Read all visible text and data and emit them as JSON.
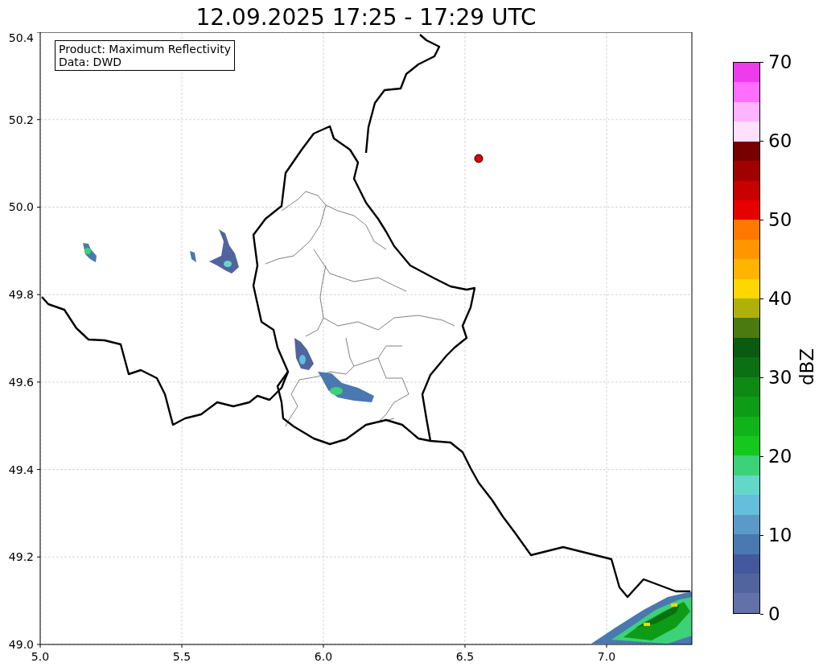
{
  "title": "12.09.2025 17:25 - 17:29 UTC",
  "info_box": [
    "Product: Maximum Reflectivity",
    "Data: DWD"
  ],
  "map": {
    "xticks": [
      "5.0",
      "5.5",
      "6.0",
      "6.5",
      "7.0"
    ],
    "yticks": [
      "50.4",
      "50.2",
      "50.0",
      "49.8",
      "49.6",
      "49.4",
      "49.2",
      "49.0"
    ]
  },
  "colorbar": {
    "label": "dBZ",
    "ticks": [
      "70",
      "60",
      "50",
      "40",
      "30",
      "20",
      "10",
      "0"
    ],
    "bins": [
      {
        "color": "#ee3bee"
      },
      {
        "color": "#ff6eff"
      },
      {
        "color": "#ffb4ff"
      },
      {
        "color": "#ffe0ff"
      },
      {
        "color": "#780000"
      },
      {
        "color": "#a00000"
      },
      {
        "color": "#c80000"
      },
      {
        "color": "#e60000"
      },
      {
        "color": "#ff7800"
      },
      {
        "color": "#ff9600"
      },
      {
        "color": "#ffb400"
      },
      {
        "color": "#ffd700"
      },
      {
        "color": "#b0b00a"
      },
      {
        "color": "#4a7a10"
      },
      {
        "color": "#0a5a10"
      },
      {
        "color": "#0a7012"
      },
      {
        "color": "#0c8a12"
      },
      {
        "color": "#0e9c16"
      },
      {
        "color": "#10b41a"
      },
      {
        "color": "#14c81e"
      },
      {
        "color": "#3cd278"
      },
      {
        "color": "#64d8c8"
      },
      {
        "color": "#64bedc"
      },
      {
        "color": "#5a9ac8"
      },
      {
        "color": "#4a78b0"
      },
      {
        "color": "#44589e"
      },
      {
        "color": "#52649e"
      },
      {
        "color": "#6272a8"
      }
    ]
  }
}
